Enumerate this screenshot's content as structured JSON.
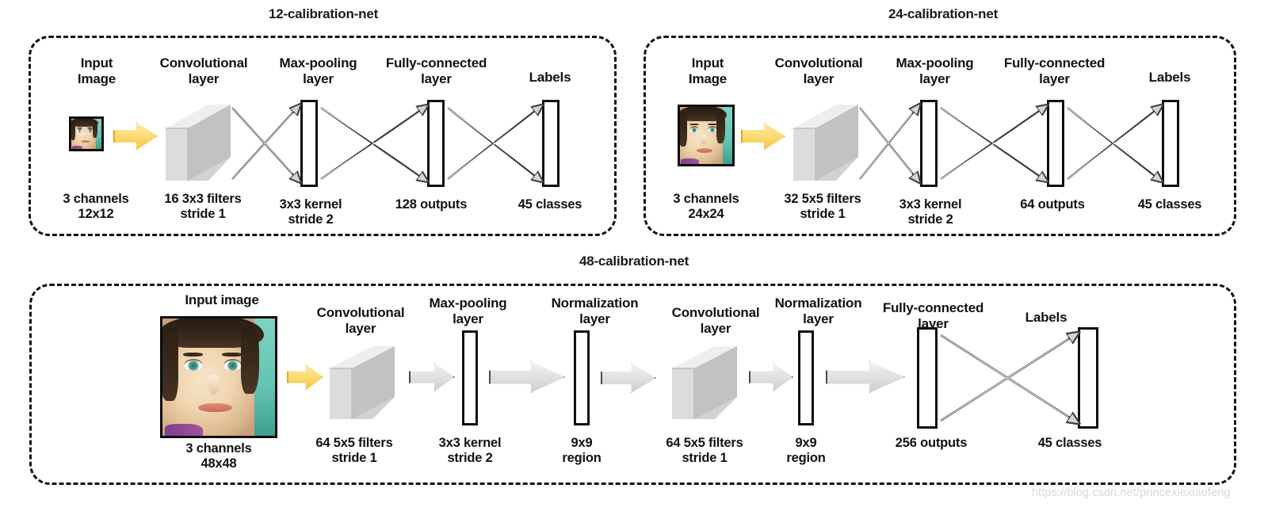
{
  "diagram": {
    "title_12": "12-calibration-net",
    "title_24": "24-calibration-net",
    "title_48": "48-calibration-net",
    "watermark": "https://blog.csdn.net/princexiexiaofeng"
  },
  "net12": {
    "stages": [
      {
        "name": "input-image",
        "top_label": "Input\nImage",
        "bottom_label": "3 channels\n12x12"
      },
      {
        "name": "conv-layer",
        "top_label": "Convolutional\nlayer",
        "bottom_label": "16 3x3 filters\nstride 1"
      },
      {
        "name": "maxpool-layer",
        "top_label": "Max-pooling\nlayer",
        "bottom_label": "3x3 kernel\nstride 2"
      },
      {
        "name": "fc-layer",
        "top_label": "Fully-connected\nlayer",
        "bottom_label": "128 outputs"
      },
      {
        "name": "labels",
        "top_label": "Labels",
        "bottom_label": "45 classes"
      }
    ]
  },
  "net24": {
    "stages": [
      {
        "name": "input-image",
        "top_label": "Input\nImage",
        "bottom_label": "3 channels\n24x24"
      },
      {
        "name": "conv-layer",
        "top_label": "Convolutional\nlayer",
        "bottom_label": "32 5x5 filters\nstride 1"
      },
      {
        "name": "maxpool-layer",
        "top_label": "Max-pooling\nlayer",
        "bottom_label": "3x3 kernel\nstride 2"
      },
      {
        "name": "fc-layer",
        "top_label": "Fully-connected\nlayer",
        "bottom_label": "64 outputs"
      },
      {
        "name": "labels",
        "top_label": "Labels",
        "bottom_label": "45 classes"
      }
    ]
  },
  "net48": {
    "stages": [
      {
        "name": "input-image",
        "top_label": "Input image",
        "bottom_label": "3 channels\n48x48"
      },
      {
        "name": "conv-layer-1",
        "top_label": "Convolutional\nlayer",
        "bottom_label": "64 5x5 filters\nstride 1"
      },
      {
        "name": "maxpool-layer",
        "top_label": "Max-pooling\nlayer",
        "bottom_label": "3x3 kernel\nstride 2"
      },
      {
        "name": "norm-layer-1",
        "top_label": "Normalization\nlayer",
        "bottom_label": "9x9\nregion"
      },
      {
        "name": "conv-layer-2",
        "top_label": "Convolutional\nlayer",
        "bottom_label": "64 5x5 filters\nstride 1"
      },
      {
        "name": "norm-layer-2",
        "top_label": "Normalization\nlayer",
        "bottom_label": "9x9\nregion"
      },
      {
        "name": "fc-layer",
        "top_label": "Fully-connected\nlayer",
        "bottom_label": "256 outputs"
      },
      {
        "name": "labels",
        "top_label": "Labels",
        "bottom_label": "45 classes"
      }
    ]
  },
  "colors": {
    "arrow_yellow_fill": "#fbd96f",
    "arrow_yellow_stroke": "#e8a825",
    "arrow_gray_fill": "#e2e2e2",
    "arrow_gray_stroke": "#4a4a4a",
    "cube_face": "#d6d6d6",
    "cube_top": "#eaeaea",
    "cube_side": "#c0c0c0",
    "outline": "#0f0f0f",
    "panel_border": "#111111"
  }
}
